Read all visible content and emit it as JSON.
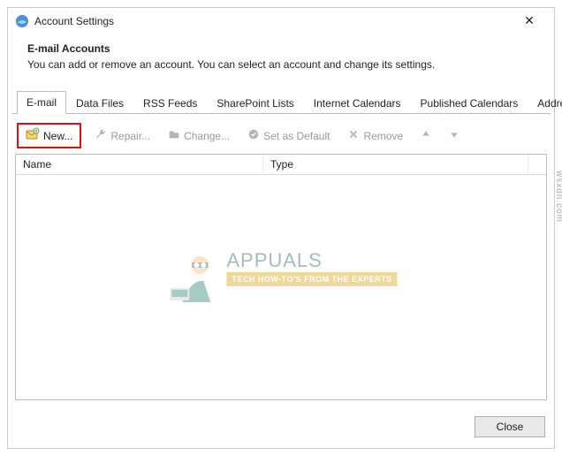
{
  "window": {
    "title": "Account Settings"
  },
  "intro": {
    "heading": "E-mail Accounts",
    "sub": "You can add or remove an account. You can select an account and change its settings."
  },
  "tabs": [
    {
      "label": "E-mail",
      "active": true
    },
    {
      "label": "Data Files"
    },
    {
      "label": "RSS Feeds"
    },
    {
      "label": "SharePoint Lists"
    },
    {
      "label": "Internet Calendars"
    },
    {
      "label": "Published Calendars"
    },
    {
      "label": "Address Books"
    }
  ],
  "toolbar": {
    "new": "New...",
    "repair": "Repair...",
    "change": "Change...",
    "default": "Set as Default",
    "remove": "Remove"
  },
  "columns": {
    "name": "Name",
    "type": "Type"
  },
  "footer": {
    "close": "Close"
  },
  "watermark": {
    "title": "APPUALS",
    "sub": "TECH HOW-TO'S FROM THE EXPERTS",
    "side": "wsxdn.com"
  }
}
